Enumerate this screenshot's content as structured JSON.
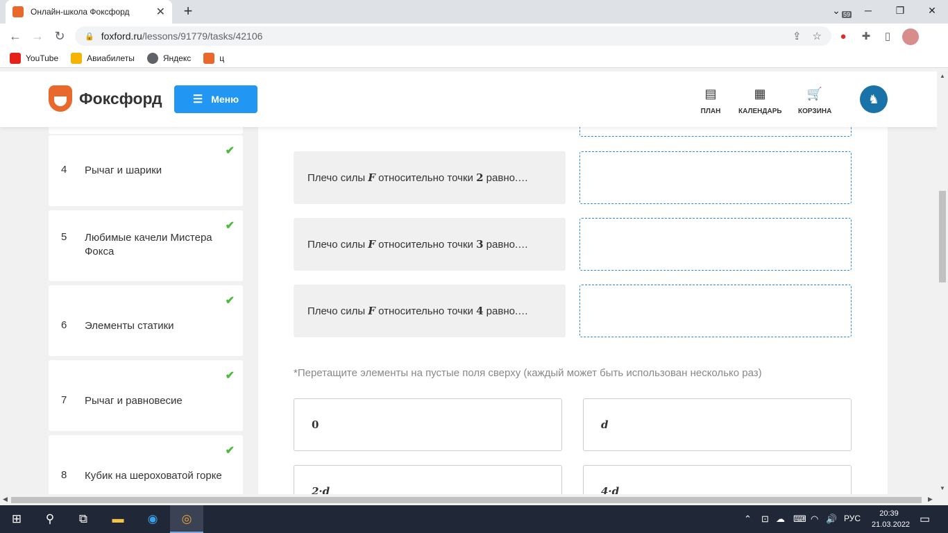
{
  "browser": {
    "tab_title": "Онлайн-школа Фоксфорд",
    "tab_close": "✕",
    "new_tab": "+",
    "url_host": "foxford.ru",
    "url_path": "/lessons/91779/tasks/42106",
    "extension_badge": "59",
    "bookmarks": [
      "YouTube",
      "Авиабилеты",
      "Яндекс",
      "ц"
    ]
  },
  "header": {
    "brand": "Фоксфорд",
    "menu_label": "Меню",
    "nav": {
      "plan": "ПЛАН",
      "calendar": "КАЛЕНДАРЬ",
      "cart": "КОРЗИНА"
    }
  },
  "sidebar": {
    "items": [
      {
        "num": "4",
        "title": "Рычаг и шарики"
      },
      {
        "num": "5",
        "title": "Любимые качели Мистера Фокса"
      },
      {
        "num": "6",
        "title": "Элементы статики"
      },
      {
        "num": "7",
        "title": "Рычаг и равновесие"
      },
      {
        "num": "8",
        "title": "Кубик на шероховатой горке"
      }
    ]
  },
  "task": {
    "questions": [
      {
        "prefix": "Плечо силы ",
        "force": "F",
        "middle": " относительно точки ",
        "point": "2",
        "suffix": " равно.…"
      },
      {
        "prefix": "Плечо силы ",
        "force": "F",
        "middle": " относительно точки ",
        "point": "3",
        "suffix": " равно.…"
      },
      {
        "prefix": "Плечо силы ",
        "force": "F",
        "middle": " относительно точки ",
        "point": "4",
        "suffix": " равно.…"
      }
    ],
    "hint": "*Перетащите элементы на пустые поля сверху (каждый может быть использован несколько раз)",
    "options": [
      "0",
      "d",
      "2·d",
      "4·d"
    ]
  },
  "taskbar": {
    "lang": "РУС",
    "time": "20:39",
    "date": "21.03.2022"
  },
  "colors": {
    "accent": "#2196f3",
    "check": "#4cba3c",
    "drop_border": "#2b8bd8",
    "brand_orange": "#e8692b"
  }
}
